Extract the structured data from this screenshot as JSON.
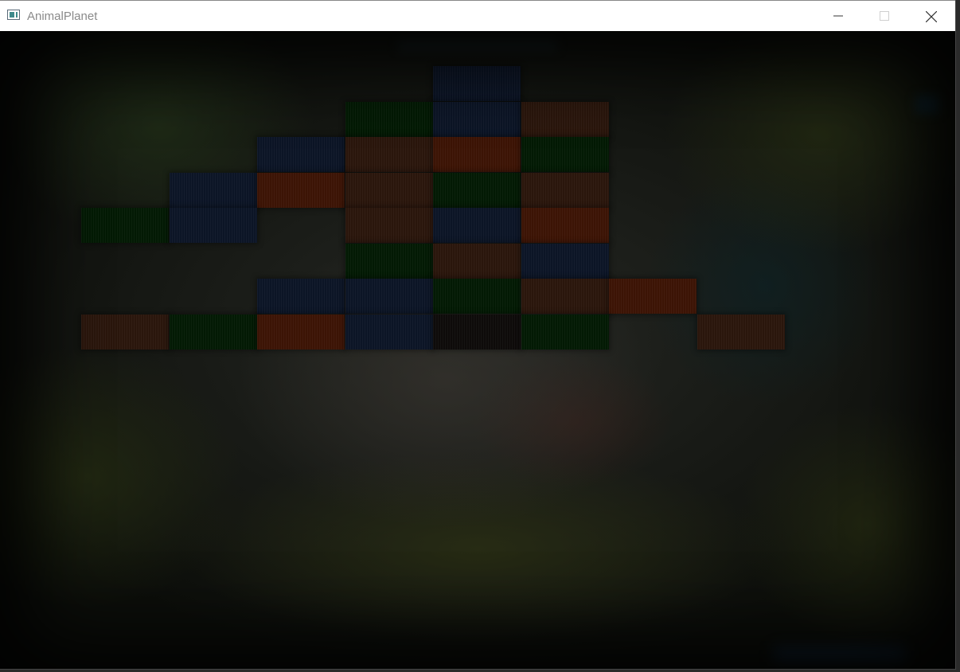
{
  "window": {
    "title": "AnimalPlanet",
    "controls": {
      "minimize_icon": "minimize-icon",
      "maximize_icon": "maximize-icon",
      "close_icon": "close-icon"
    }
  },
  "colors": {
    "navy": "#0c1526",
    "green": "#031a04",
    "brown": "#2a160c",
    "orange": "#3c1405",
    "dark": "#0e0b0a"
  },
  "board": {
    "rows": [
      [
        "",
        "",
        "",
        "",
        "navy",
        "",
        "",
        "",
        ""
      ],
      [
        "",
        "",
        "",
        "green",
        "navy",
        "brown",
        "",
        "",
        ""
      ],
      [
        "",
        "",
        "navy",
        "brown",
        "orange",
        "green",
        "",
        "",
        ""
      ],
      [
        "",
        "navy",
        "orange",
        "brown",
        "green",
        "brown",
        "",
        "",
        ""
      ],
      [
        "green",
        "navy",
        "",
        "brown",
        "navy",
        "orange",
        "",
        "",
        ""
      ],
      [
        "",
        "",
        "",
        "green",
        "brown",
        "navy",
        "",
        "",
        ""
      ],
      [
        "",
        "",
        "navy",
        "navy",
        "green",
        "brown",
        "orange",
        "",
        ""
      ],
      [
        "brown",
        "green",
        "orange",
        "navy",
        "dark",
        "green",
        "",
        "brown",
        ""
      ]
    ]
  }
}
